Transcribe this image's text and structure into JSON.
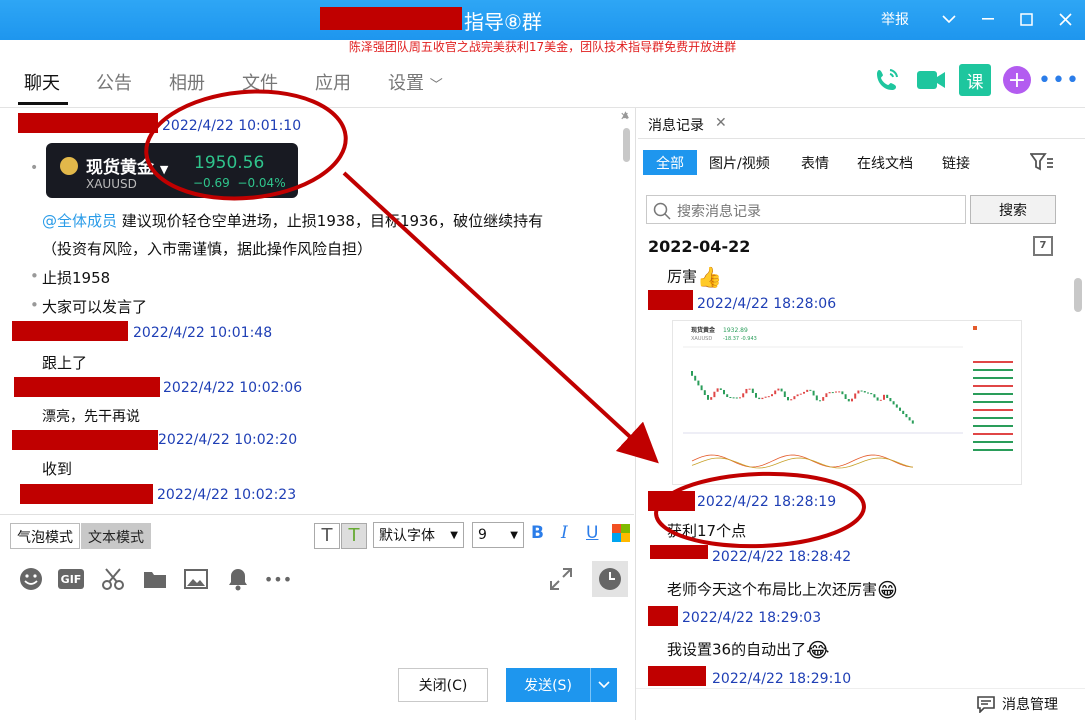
{
  "titlebar": {
    "title": "指导⑧群",
    "report": "举报"
  },
  "banner": "陈泽强团队周五收官之战完美获利17美金，团队技术指导群免费开放进群",
  "tabs": [
    "聊天",
    "公告",
    "相册",
    "文件",
    "应用",
    "设置"
  ],
  "chat": {
    "ts1": "2022/4/22 10:01:10",
    "card": {
      "name": "现货黄金",
      "code": "XAUUSD",
      "price": "1950.56",
      "change": "−0.69",
      "change_pct": "−0.04%"
    },
    "mention": "@全体成员",
    "m1": "建议现价轻仓空单进场，止损1938，目标1936，破位继续持有",
    "m1b": "（投资有风险，入市需谨慎，据此操作风险自担）",
    "m2": "止损1958",
    "m3": "大家可以发言了",
    "ts2": "2022/4/22 10:01:48",
    "m4": "跟上了",
    "ts3": "2022/4/22 10:02:06",
    "m5": "漂亮，先干再说",
    "ts4": "2022/4/22 10:02:20",
    "m6": "收到",
    "ts5": "2022/4/22 10:02:23"
  },
  "input": {
    "bubble_mode": "气泡模式",
    "text_mode": "文本模式",
    "font": "默认字体",
    "font_size": "9",
    "bold": "B",
    "italic": "I",
    "underline": "U",
    "gif": "GIF",
    "close": "关闭(C)",
    "send": "发送(S)"
  },
  "history": {
    "tab": "消息记录",
    "filters": [
      "全部",
      "图片/视频",
      "表情",
      "在线文档",
      "链接"
    ],
    "search_placeholder": "搜索消息记录",
    "search_btn": "搜索",
    "date": "2022-04-22",
    "calendar_day": "7",
    "r1": "厉害",
    "ts1": "2022/4/22 18:28:06",
    "ts2": "2022/4/22 18:28:19",
    "r2": "获利17个点",
    "ts3": "2022/4/22 18:28:42",
    "r3": "老师今天这个布局比上次还厉害",
    "ts4": "2022/4/22 18:29:03",
    "r4": "我设置36的自动出了",
    "ts5": "2022/4/22 18:29:10",
    "manage": "消息管理"
  },
  "mini_chart": {
    "name": "现货黄金",
    "code": "XAUUSD",
    "price": "1932.89",
    "change": "-18.37 -0.943"
  },
  "colors": {
    "titlebar": "#1e96ee",
    "redaction": "#c00000",
    "annotation": "#c00000",
    "timestamp": "#1f3fb5"
  }
}
